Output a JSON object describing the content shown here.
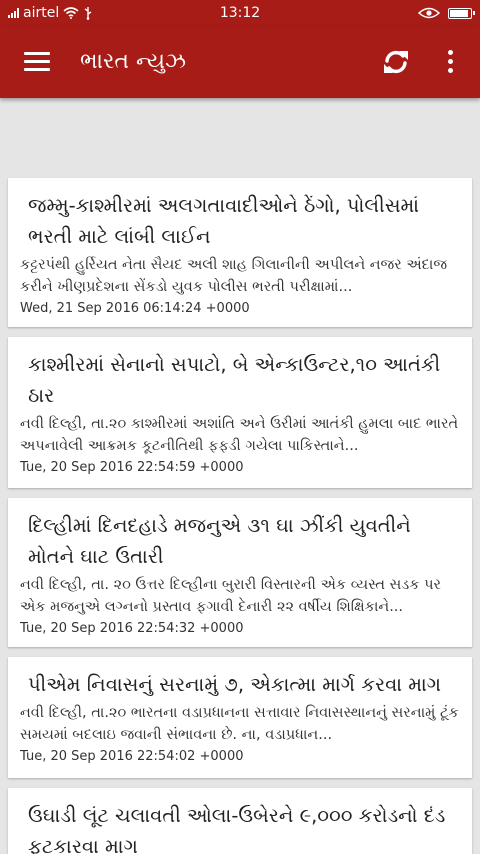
{
  "status_bar": {
    "carrier": "airtel",
    "time": "13:12"
  },
  "app_bar": {
    "title": "ભારત ન્યુઝ",
    "menu_icon": "hamburger-menu-icon",
    "refresh_icon": "refresh-icon",
    "overflow_icon": "more-vertical-icon",
    "color": "#a81c18"
  },
  "articles": [
    {
      "title": "જમ્મુ-કાશ્મીરમાં અલગતાવાદીઓને ઠેંગો, પોલીસમાં ભરતી માટે લાંબી લાઈન",
      "summary": "કટ્ટરપંથી હુર્રિયત નેતા સૈયદ અલી શાહ ગિલાનીની અપીલને નજર અંદાજ કરીને ખીણપ્રદેશના સેંકડો યુવક પોલીસ ભરતી પરીક્ષામાં...",
      "date": "Wed, 21 Sep 2016 06:14:24 +0000"
    },
    {
      "title": "કાશ્મીરમાં સેનાનો સપાટો, બે એન્કાઉન્ટર,૧૦ આતંકી ઠાર",
      "summary": "નવી દિલ્હી, તા.૨૦  કાશ્મીરમાં અશાંતિ અને ઉરીમાં આતંકી હુમલા બાદ ભારતે અપનાવેલી આક્રમક કૂટનીતિથી ફફડી ગયેલા પાકિસ્તાને...",
      "date": "Tue, 20 Sep 2016 22:54:59 +0000"
    },
    {
      "title": "દિલ્હીમાં દિનદહાડે મજનુએ ૩૧ ઘા ઝીંકી યુવતીને મોતને ઘાટ ઉતારી",
      "summary": "નવી દિલ્હી, તા. ૨૦  ઉત્તર દિલ્હીના બુરારી વિસ્તારની એક વ્યસ્ત સડક પર એક મજનુએ લગ્નનો પ્રસ્તાવ ફગાવી દેનારી ૨૨ વર્ષીય શિક્ષિકાને...",
      "date": "Tue, 20 Sep 2016 22:54:32 +0000"
    },
    {
      "title": "પીએમ નિવાસનું સરનામું ૭, એકાત્મા માર્ગ કરવા માગ",
      "summary": "નવી દિલ્હી, તા.૨૦  ભારતના વડાપ્રધાનના સત્તાવાર નિવાસસ્થાનનું સરનામું ટૂંક સમયમાં બદલાઇ જવાની સંભાવના છે. ના, વડાપ્રધાન...",
      "date": "Tue, 20 Sep 2016 22:54:02 +0000"
    },
    {
      "title": "ઉઘાડી લૂંટ ચલાવતી ઓલા-ઉબેરને ૯,૦૦૦ કરોડનો દંડ ફટકારવા માગ",
      "summary": "",
      "date": ""
    }
  ]
}
